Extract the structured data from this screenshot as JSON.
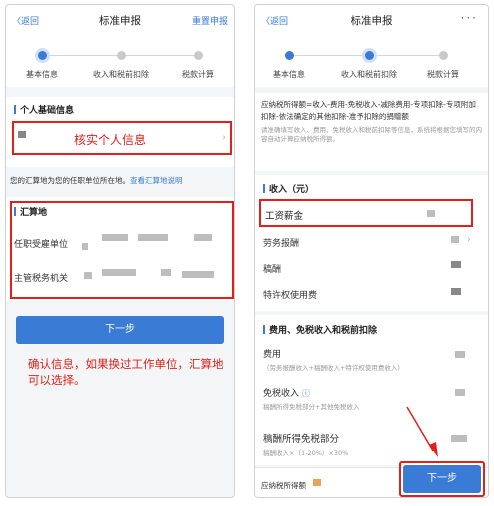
{
  "left": {
    "back": "〈返回",
    "title": "标准申报",
    "reset": "重置申报",
    "steps": [
      "基本信息",
      "收入和税前扣除",
      "税款计算"
    ],
    "section_personal": "个人基础信息",
    "annotation_verify": "核实个人信息",
    "notice_text": "您的汇算地为您的任职单位所在地。",
    "notice_link": "查看汇算地说明",
    "section_settle": "汇算地",
    "row_employer": "任职受雇单位",
    "row_tax_office": "主管税务机关",
    "next_button": "下一步",
    "annotation_confirm": "确认信息，如果换过工作单位，汇算地可以选择。"
  },
  "right": {
    "back": "〈返回",
    "title": "标准申报",
    "more": "···",
    "steps": [
      "基本信息",
      "收入和税前扣除",
      "税款计算"
    ],
    "formula": "应纳税所得额=收入-费用-免税收入-减除费用-专项扣除-专项附加扣除-依法确定的其他扣除-准予扣除的捐赠额",
    "formula_hint": "请准确填写收入、费用、免税收入和税前扣除等信息，系统将根据您填写的内容自动计算应纳税所得额。",
    "section_income": "收入（元）",
    "row_salary": "工资薪金",
    "row_labor": "劳务报酬",
    "row_royalty": "稿酬",
    "row_license": "特许权使用费",
    "section_deduct": "费用、免税收入和税前扣除",
    "row_expense": "费用",
    "row_expense_hint": "（劳务报酬收入+稿酬收入+特许权使用费收入）",
    "row_exempt": "免税收入",
    "row_exempt_hint": "稿酬所得免税部分+其他免税收入",
    "row_royalty_exempt": "稿酬所得免税部分",
    "row_royalty_exempt_hint": "稿酬收入×（1-20%）×30%",
    "bottom_label": "应纳税所得额",
    "next_button": "下一步"
  },
  "colors": {
    "accent": "#3a7bd5",
    "annotation_red": "#e0201a"
  }
}
